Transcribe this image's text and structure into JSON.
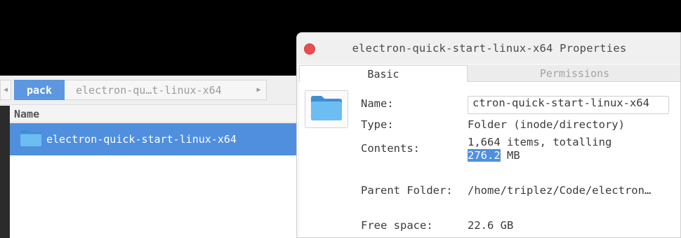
{
  "file_manager": {
    "breadcrumb": {
      "active": "pack",
      "next": "electron-qu…t-linux-x64",
      "left_arrow": "◀",
      "right_arrow": "▶"
    },
    "column_header": "Name",
    "row": {
      "label": "electron-quick-start-linux-x64",
      "icon": "folder-icon"
    }
  },
  "dialog": {
    "title": "electron-quick-start-linux-x64 Properties",
    "tabs": {
      "basic": "Basic",
      "permissions": "Permissions"
    },
    "fields": {
      "name_label": "Name:",
      "name_value": "ctron-quick-start-linux-x64",
      "type_label": "Type:",
      "type_value": "Folder (inode/directory)",
      "contents_label": "Contents:",
      "contents_line1": "1,664 items, totalling",
      "contents_size": "276.2",
      "contents_unit": " MB",
      "parent_label": "Parent Folder:",
      "parent_value": "/home/triplez/Code/electron…",
      "free_label": "Free space:",
      "free_value": "22.6 GB"
    }
  },
  "colors": {
    "selection": "#4f8fde",
    "close_button": "#ea4d4d"
  }
}
